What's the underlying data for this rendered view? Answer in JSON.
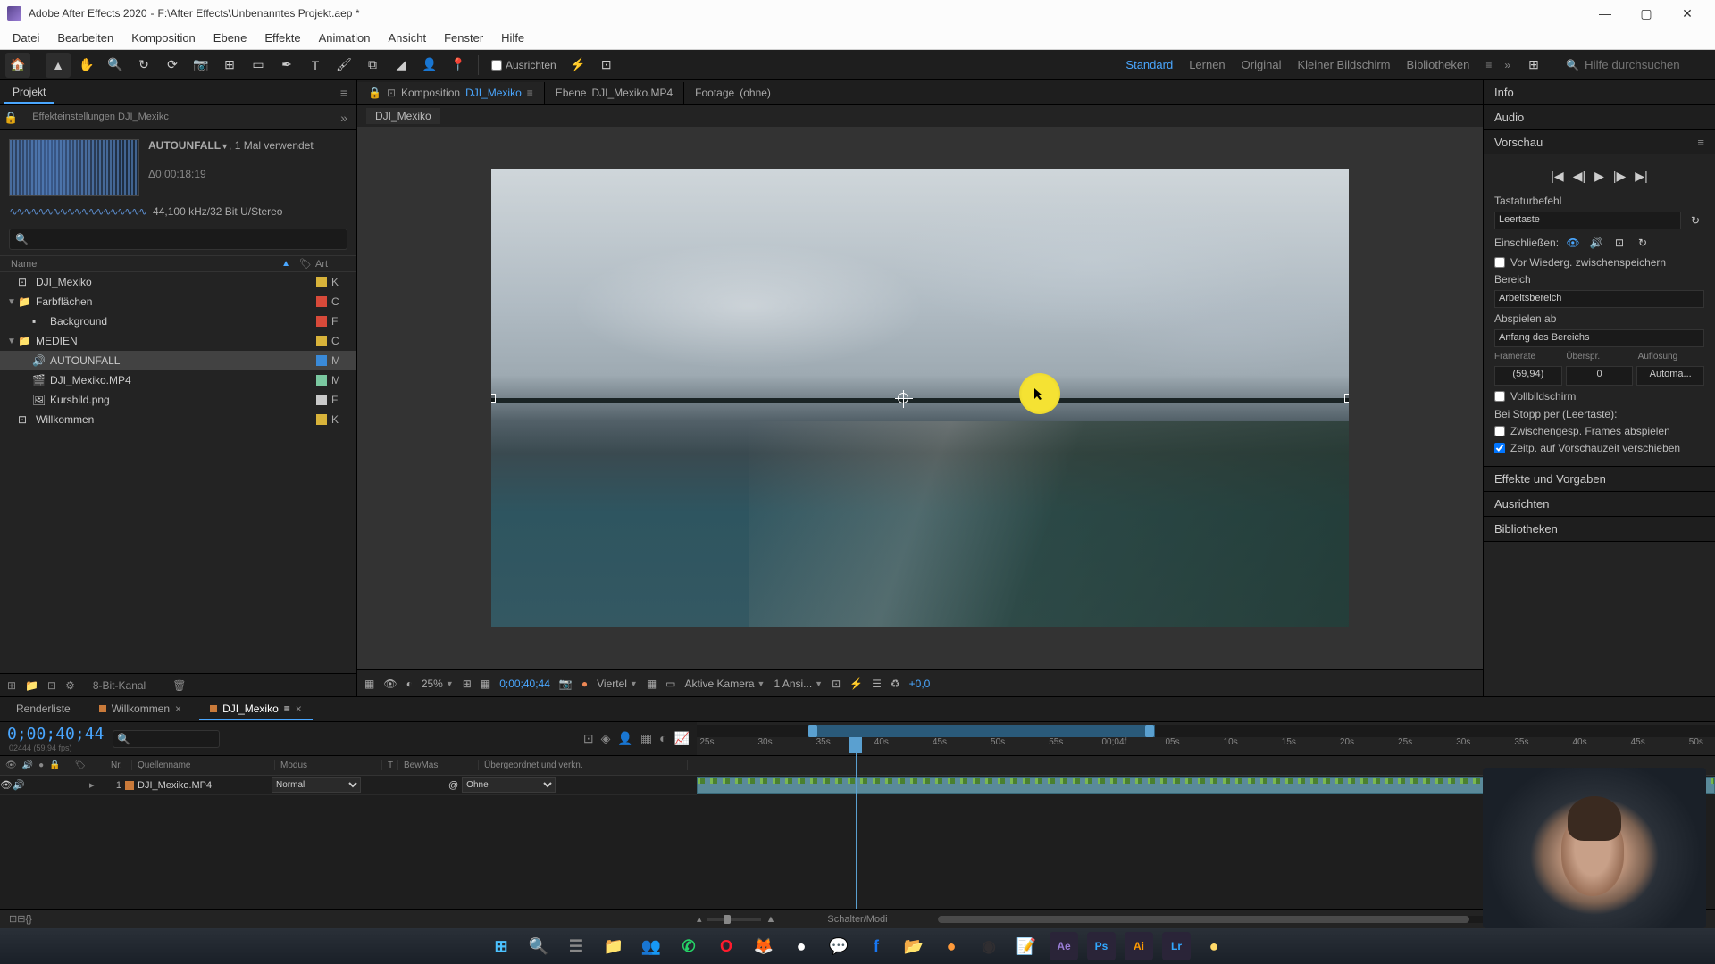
{
  "titlebar": {
    "app": "Adobe After Effects 2020",
    "path": "F:\\After Effects\\Unbenanntes Projekt.aep *"
  },
  "menu": [
    "Datei",
    "Bearbeiten",
    "Komposition",
    "Ebene",
    "Effekte",
    "Animation",
    "Ansicht",
    "Fenster",
    "Hilfe"
  ],
  "toolbar": {
    "align": "Ausrichten",
    "workspaces": [
      "Standard",
      "Lernen",
      "Original",
      "Kleiner Bildschirm",
      "Bibliotheken"
    ],
    "active_ws": 0,
    "search_placeholder": "Hilfe durchsuchen"
  },
  "project_panel": {
    "tab": "Projekt",
    "effects_tab": "Effekteinstellungen DJI_Mexikc",
    "asset_name": "AUTOUNFALL",
    "asset_usage": ", 1 Mal verwendet",
    "asset_duration": "Δ0:00:18:19",
    "asset_audio": "44,100 kHz/32 Bit U/Stereo",
    "head": {
      "name": "Name",
      "art": "Art"
    },
    "items": [
      {
        "icon": "comp",
        "label": "DJI_Mexiko",
        "swatch": "#d8b33a",
        "art": "K",
        "depth": 0,
        "arrow": ""
      },
      {
        "icon": "folder",
        "label": "Farbflächen",
        "swatch": "#d84a3a",
        "art": "C",
        "depth": 0,
        "arrow": "▼"
      },
      {
        "icon": "solid",
        "label": "Background",
        "swatch": "#d84a3a",
        "art": "F",
        "depth": 1,
        "arrow": ""
      },
      {
        "icon": "folder",
        "label": "MEDIEN",
        "swatch": "#d8b33a",
        "art": "C",
        "depth": 0,
        "arrow": "▼"
      },
      {
        "icon": "audio",
        "label": "AUTOUNFALL",
        "swatch": "#3a8ad8",
        "art": "M",
        "depth": 1,
        "arrow": "",
        "selected": true
      },
      {
        "icon": "video",
        "label": "DJI_Mexiko.MP4",
        "swatch": "#7ac8a0",
        "art": "M",
        "depth": 1,
        "arrow": ""
      },
      {
        "icon": "image",
        "label": "Kursbild.png",
        "swatch": "#c9c9c9",
        "art": "F",
        "depth": 1,
        "arrow": ""
      },
      {
        "icon": "comp",
        "label": "Willkommen",
        "swatch": "#d8b33a",
        "art": "K",
        "depth": 0,
        "arrow": ""
      }
    ],
    "footer_depth": "8-Bit-Kanal"
  },
  "comp_tabs": [
    {
      "prefix": "Komposition",
      "name": "DJI_Mexiko",
      "active": true,
      "link": true
    },
    {
      "prefix": "Ebene",
      "name": "DJI_Mexiko.MP4",
      "active": false
    },
    {
      "prefix": "Footage",
      "name": "(ohne)",
      "active": false
    }
  ],
  "flow_crumb": "DJI_Mexiko",
  "viewer_ctrl": {
    "zoom": "25%",
    "timecode": "0;00;40;44",
    "resolution": "Viertel",
    "camera": "Aktive Kamera",
    "views": "1 Ansi...",
    "exposure": "+0,0"
  },
  "right": {
    "info": "Info",
    "audio": "Audio",
    "preview": "Vorschau",
    "shortcut_label": "Tastaturbefehl",
    "shortcut_value": "Leertaste",
    "include": "Einschließen:",
    "cache": "Vor Wiederg. zwischenspeichern",
    "range_label": "Bereich",
    "range_value": "Arbeitsbereich",
    "playfrom_label": "Abspielen ab",
    "playfrom_value": "Anfang des Bereichs",
    "framerate": "Framerate",
    "skip": "Überspr.",
    "res": "Auflösung",
    "fps": "(59,94)",
    "skip_val": "0",
    "res_val": "Automa...",
    "fullscreen": "Vollbildschirm",
    "onstop": "Bei Stopp per (Leertaste):",
    "play_cached": "Zwischengesp. Frames abspielen",
    "move_time": "Zeitp. auf Vorschauzeit verschieben",
    "effects": "Effekte und Vorgaben",
    "align_panel": "Ausrichten",
    "libraries": "Bibliotheken"
  },
  "timeline": {
    "tabs": [
      {
        "label": "Renderliste"
      },
      {
        "label": "Willkommen",
        "dot": true
      },
      {
        "label": "DJI_Mexiko",
        "dot": true,
        "active": true
      }
    ],
    "timecode": "0;00;40;44",
    "sub": "02444 (59,94 fps)",
    "ticks": [
      "25s",
      "30s",
      "35s",
      "40s",
      "45s",
      "50s",
      "55s",
      "00;04f",
      "05s",
      "10s",
      "15s",
      "20s",
      "25s",
      "30s",
      "35s",
      "40s",
      "45s",
      "50s"
    ],
    "head": {
      "nr": "Nr.",
      "source": "Quellenname",
      "mode": "Modus",
      "t": "T",
      "bm": "BewMas",
      "parent": "Übergeordnet und verkn."
    },
    "layer": {
      "num": "1",
      "name": "DJI_Mexiko.MP4",
      "mode": "Normal",
      "parent": "Ohne"
    },
    "footer": "Schalter/Modi"
  },
  "taskbar_icons": [
    "windows",
    "search",
    "tasks",
    "explorer",
    "teams",
    "whatsapp",
    "opera",
    "firefox",
    "app1",
    "messenger",
    "facebook",
    "folder",
    "app2",
    "obs",
    "notepad",
    "ae",
    "ps",
    "ai",
    "lr",
    "app3"
  ]
}
